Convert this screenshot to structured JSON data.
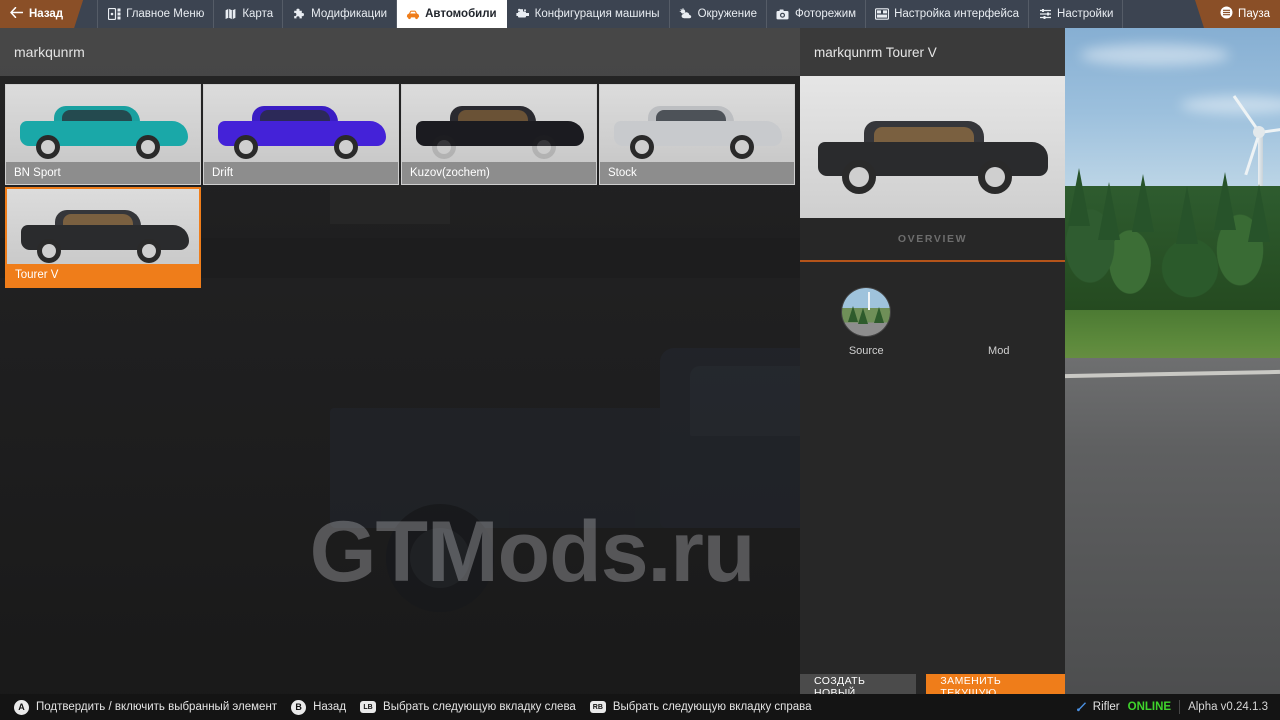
{
  "topbar": {
    "back_label": "Назад",
    "back_icon": "arrow-left-icon",
    "nav": [
      {
        "label": "Главное Меню",
        "icon": "main-menu-icon",
        "active": false
      },
      {
        "label": "Карта",
        "icon": "map-icon",
        "active": false
      },
      {
        "label": "Модификации",
        "icon": "puzzle-icon",
        "active": false
      },
      {
        "label": "Автомобили",
        "icon": "car-icon",
        "active": true
      },
      {
        "label": "Конфигурация машины",
        "icon": "engine-icon",
        "active": false
      },
      {
        "label": "Окружение",
        "icon": "weather-icon",
        "active": false
      },
      {
        "label": "Фоторежим",
        "icon": "camera-icon",
        "active": false
      },
      {
        "label": "Настройка интерфейса",
        "icon": "ui-layout-icon",
        "active": false
      },
      {
        "label": "Настройки",
        "icon": "sliders-icon",
        "active": false
      }
    ],
    "pause_label": "Пауза",
    "pause_icon": "pause-menu-icon"
  },
  "config_panel": {
    "title": "markqunrm",
    "tiles": [
      {
        "label": "BN Sport",
        "color": "#1aa8a8",
        "roof": "#19a0a0",
        "selected": false
      },
      {
        "label": "Drift",
        "color": "#4422d8",
        "roof": "#3a1dc4",
        "selected": false
      },
      {
        "label": "Kuzov(zochem)",
        "color": "#1b1b20",
        "roof": "#2a2a30",
        "selected": false
      },
      {
        "label": "Stock",
        "color": "#c8cacd",
        "roof": "#bcbec1",
        "selected": false
      },
      {
        "label": "Tourer V",
        "color": "#2a2b2d",
        "roof": "#35363a",
        "selected": true
      }
    ]
  },
  "detail_panel": {
    "title": "markqunrm Tourer V",
    "hero_color": "#2a2b2d",
    "hero_roof": "#35363a",
    "tab": "OVERVIEW",
    "mods": [
      {
        "label": "Source",
        "has_thumb": true
      },
      {
        "label": "Mod",
        "has_thumb": false
      }
    ],
    "buttons": {
      "create_new": "СОЗДАТЬ НОВЫЙ",
      "replace_current": "ЗАМЕНИТЬ ТЕКУЩУЮ"
    }
  },
  "background": {
    "watermark": "GTMods.ru"
  },
  "bottombar": {
    "hints": [
      {
        "pad": "A",
        "shape": "circle",
        "label": "Подтвердить / включить выбранный элемент"
      },
      {
        "pad": "B",
        "shape": "circle",
        "label": "Назад"
      },
      {
        "pad": "LB",
        "shape": "rect",
        "label": "Выбрать следующую вкладку слева"
      },
      {
        "pad": "RB",
        "shape": "rect",
        "label": "Выбрать следующую вкладку справа"
      }
    ],
    "user": "Rifler",
    "online": "ONLINE",
    "version": "Alpha v0.24.1.3"
  },
  "colors": {
    "accent": "#ef7d1a",
    "topbar": "#3c4451",
    "back": "#8a4f27",
    "online": "#3fd42c"
  }
}
